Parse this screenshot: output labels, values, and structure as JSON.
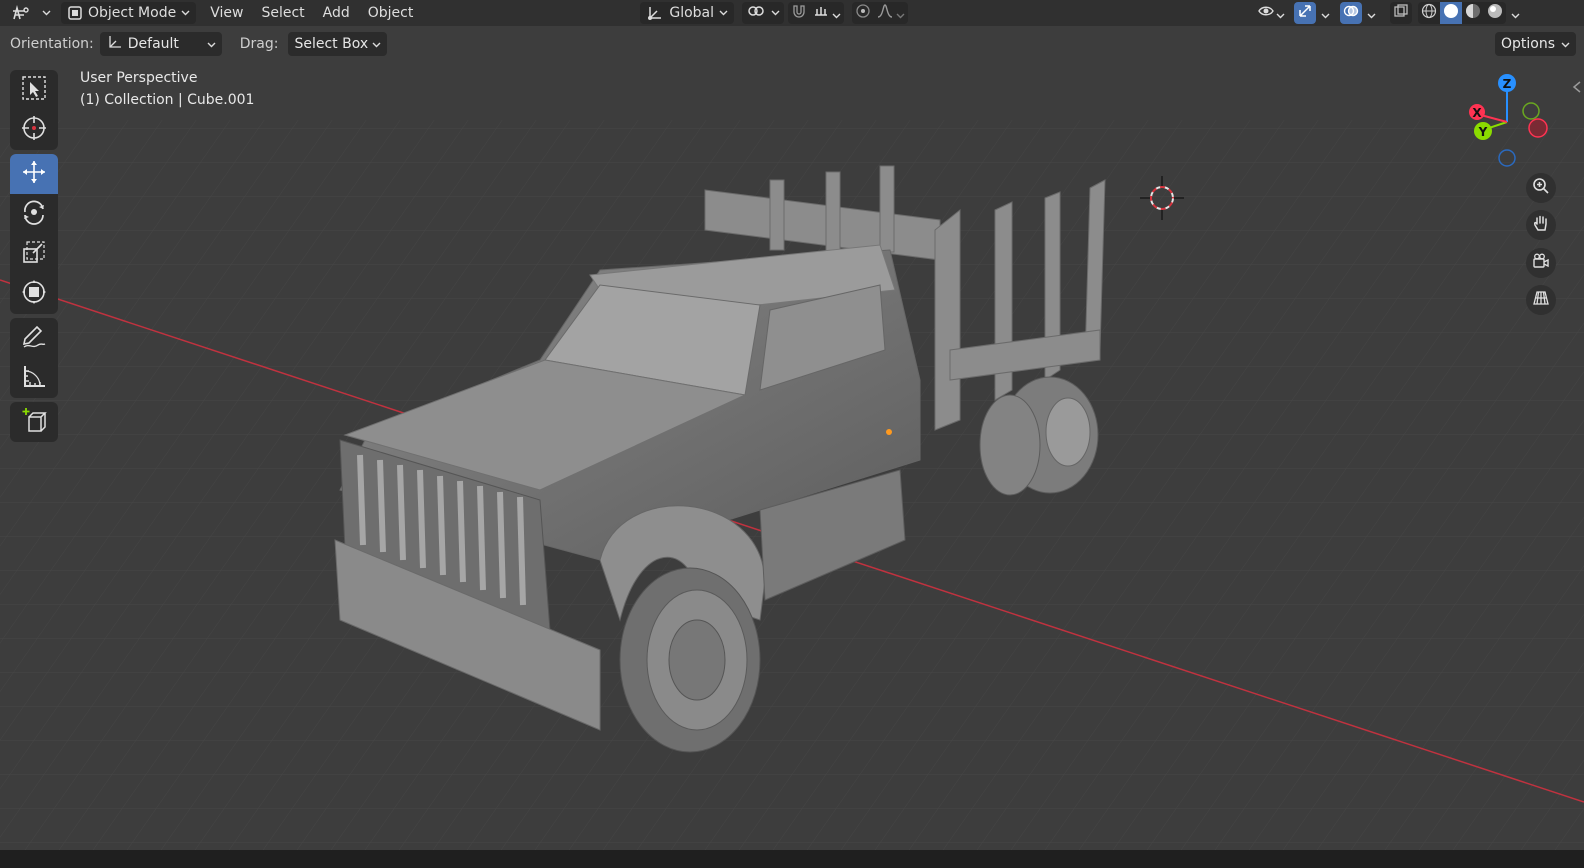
{
  "header": {
    "mode": "Object Mode",
    "menus": [
      "View",
      "Select",
      "Add",
      "Object"
    ],
    "transform_orientation": "Global"
  },
  "tool_header": {
    "orientation_label": "Orientation:",
    "orientation_value": "Default",
    "drag_label": "Drag:",
    "drag_value": "Select Box",
    "options_label": "Options"
  },
  "viewport": {
    "view_name": "User Perspective",
    "object_info": "(1) Collection | Cube.001"
  },
  "gizmo": {
    "x": "X",
    "y": "Y",
    "z": "Z"
  },
  "colors": {
    "accent": "#4772b3",
    "x_axis": "#ff3352",
    "y_axis": "#8bdc00",
    "z_axis": "#2890ff",
    "background": "#3d3d3d"
  },
  "tools": [
    "select-box",
    "cursor",
    "move",
    "rotate",
    "scale",
    "transform",
    "annotate",
    "measure",
    "add-cube"
  ],
  "navigation": [
    "zoom",
    "pan",
    "camera-view",
    "perspective-toggle"
  ]
}
